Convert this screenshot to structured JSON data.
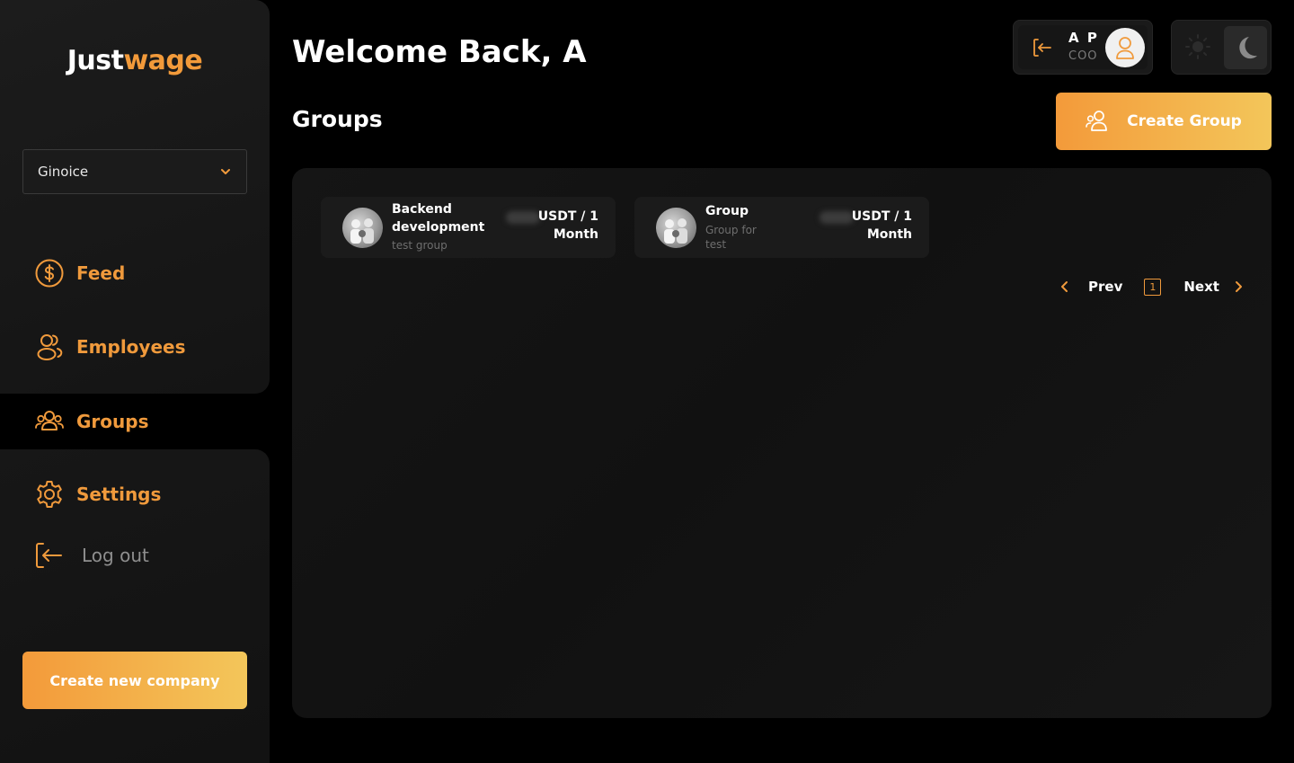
{
  "app": {
    "logo_part1": "Just",
    "logo_part2": "wage"
  },
  "sidebar": {
    "company_select": {
      "value": "Ginoice"
    },
    "items": [
      {
        "label": "Feed",
        "icon": "dollar-circle-icon"
      },
      {
        "label": "Employees",
        "icon": "users-icon"
      },
      {
        "label": "Groups",
        "icon": "group-icon",
        "active": true
      },
      {
        "label": "Settings",
        "icon": "gear-icon"
      },
      {
        "label": "Log out",
        "icon": "logout-icon"
      }
    ],
    "create_company_label": "Create new company"
  },
  "header": {
    "welcome": "Welcome Back, A",
    "section_title": "Groups",
    "user": {
      "initials": "A P",
      "role": "COO"
    },
    "create_group_label": "Create Group"
  },
  "groups": [
    {
      "name": "Backend development",
      "description": "test group",
      "price_line1": "USDT / 1",
      "price_line2": "Month"
    },
    {
      "name": "Group",
      "description": "Group for test",
      "price_line1": "USDT / 1",
      "price_line2": "Month"
    }
  ],
  "pagination": {
    "prev": "Prev",
    "page": "1",
    "next": "Next"
  },
  "colors": {
    "accent": "#f09a3c",
    "accent_light": "#f3c65a",
    "background": "#000000"
  }
}
